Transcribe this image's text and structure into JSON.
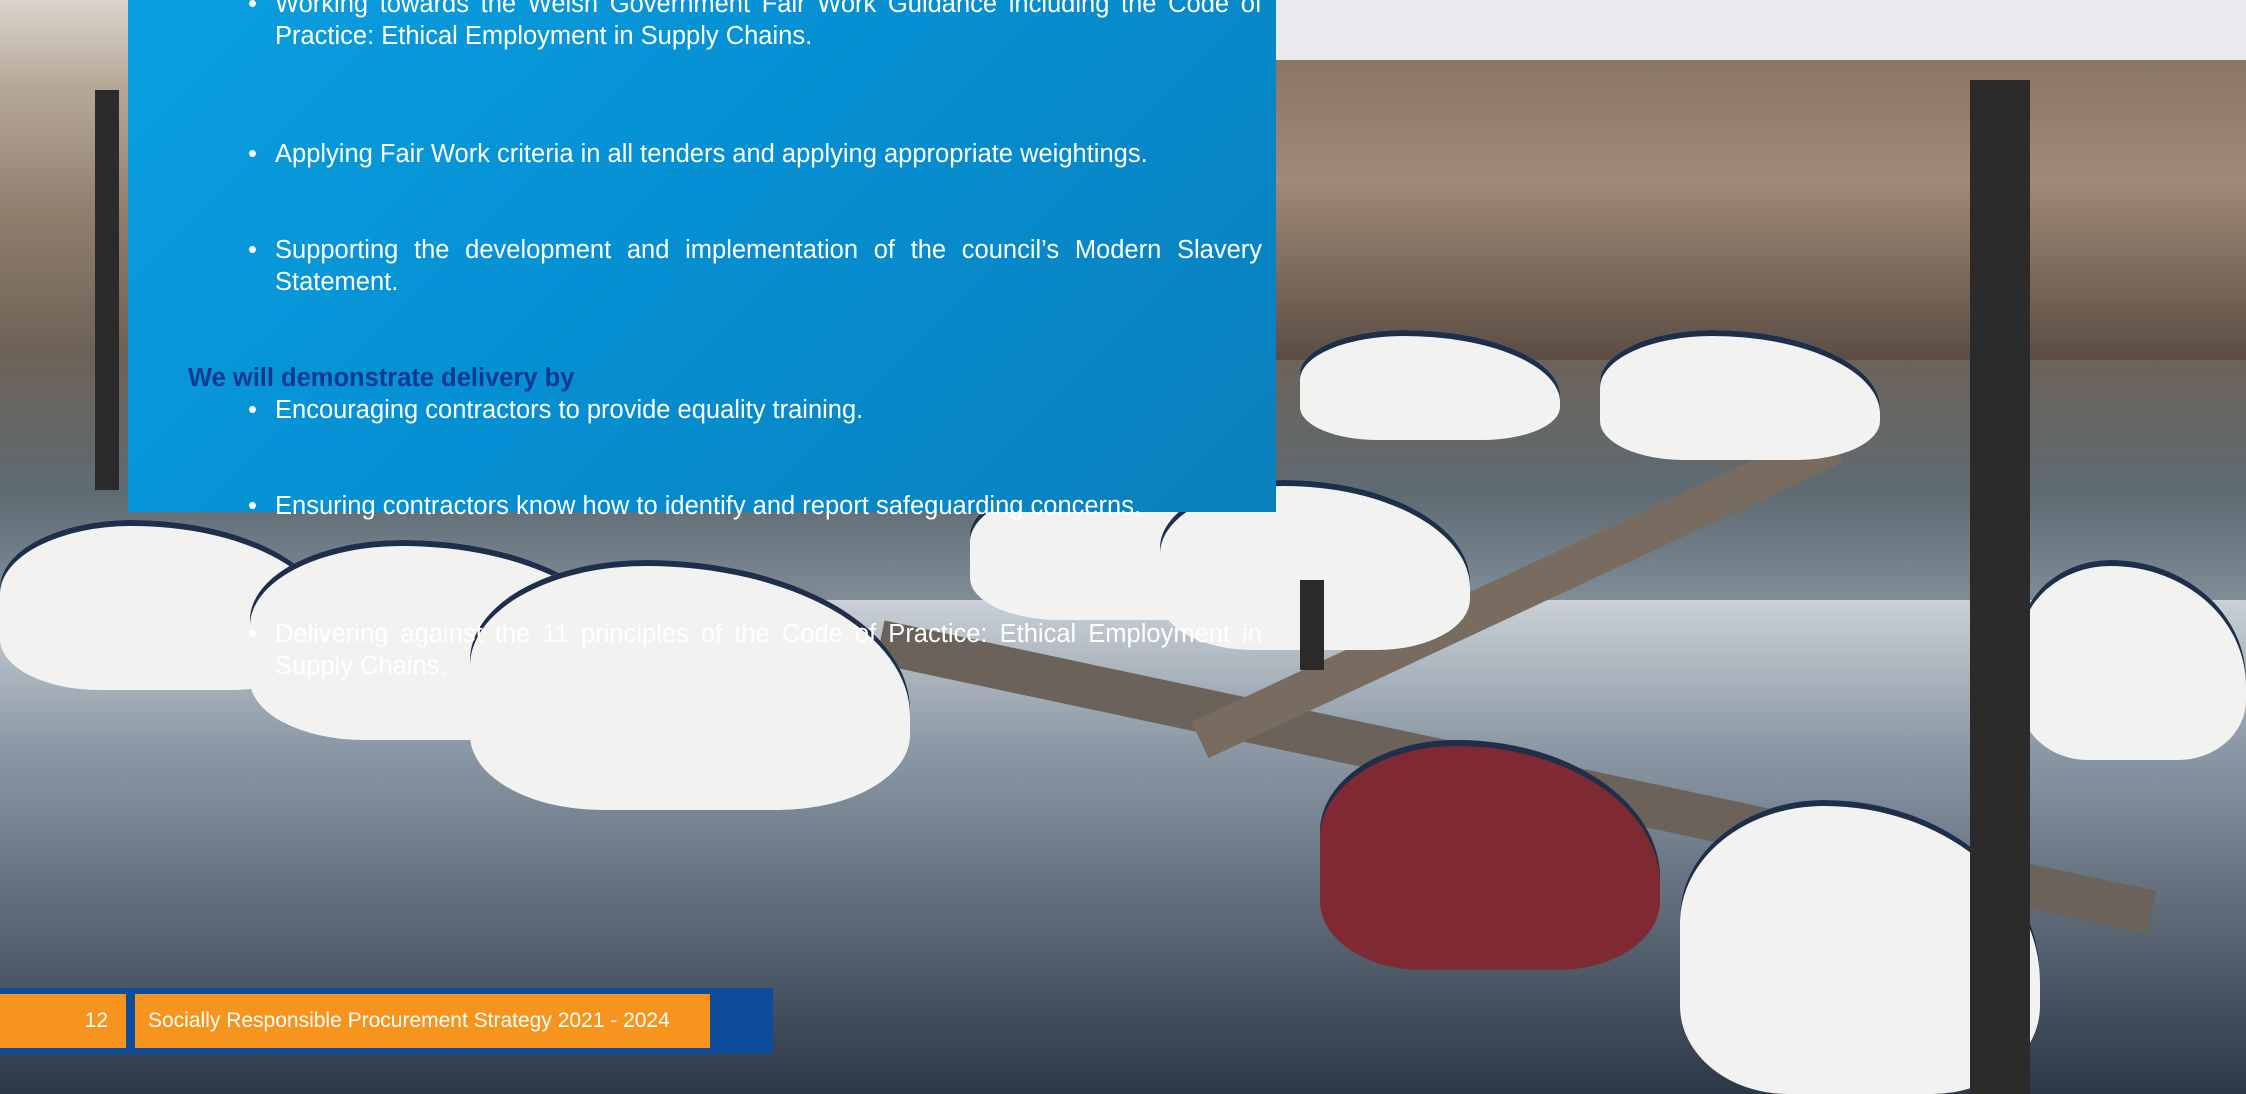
{
  "panel": {
    "bullets_top": [
      "Working towards the Welsh Government Fair Work Guidance including the Code of Practice: Ethical Employment in Supply Chains.",
      "Applying Fair Work criteria in all tenders and applying appropriate weightings.",
      "Supporting the development and implementation of the council’s Modern Slavery Statement.",
      "Encouraging contractors to provide equality training.",
      "Ensuring contractors know how to identify and report safeguarding concerns."
    ],
    "heading": "We will demonstrate delivery by",
    "bullets_bottom": [
      "Delivering against the 11 principles of the Code of Practice: Ethical Employment in Supply Chains."
    ]
  },
  "footer": {
    "page_number": "12",
    "title": "Socially Responsible Procurement Strategy 2021 - 2024"
  },
  "colors": {
    "panel_blue": "#0a9fe0",
    "heading_navy": "#0d3a8f",
    "footer_navy": "#0d4b9b",
    "footer_orange": "#f7941d"
  }
}
